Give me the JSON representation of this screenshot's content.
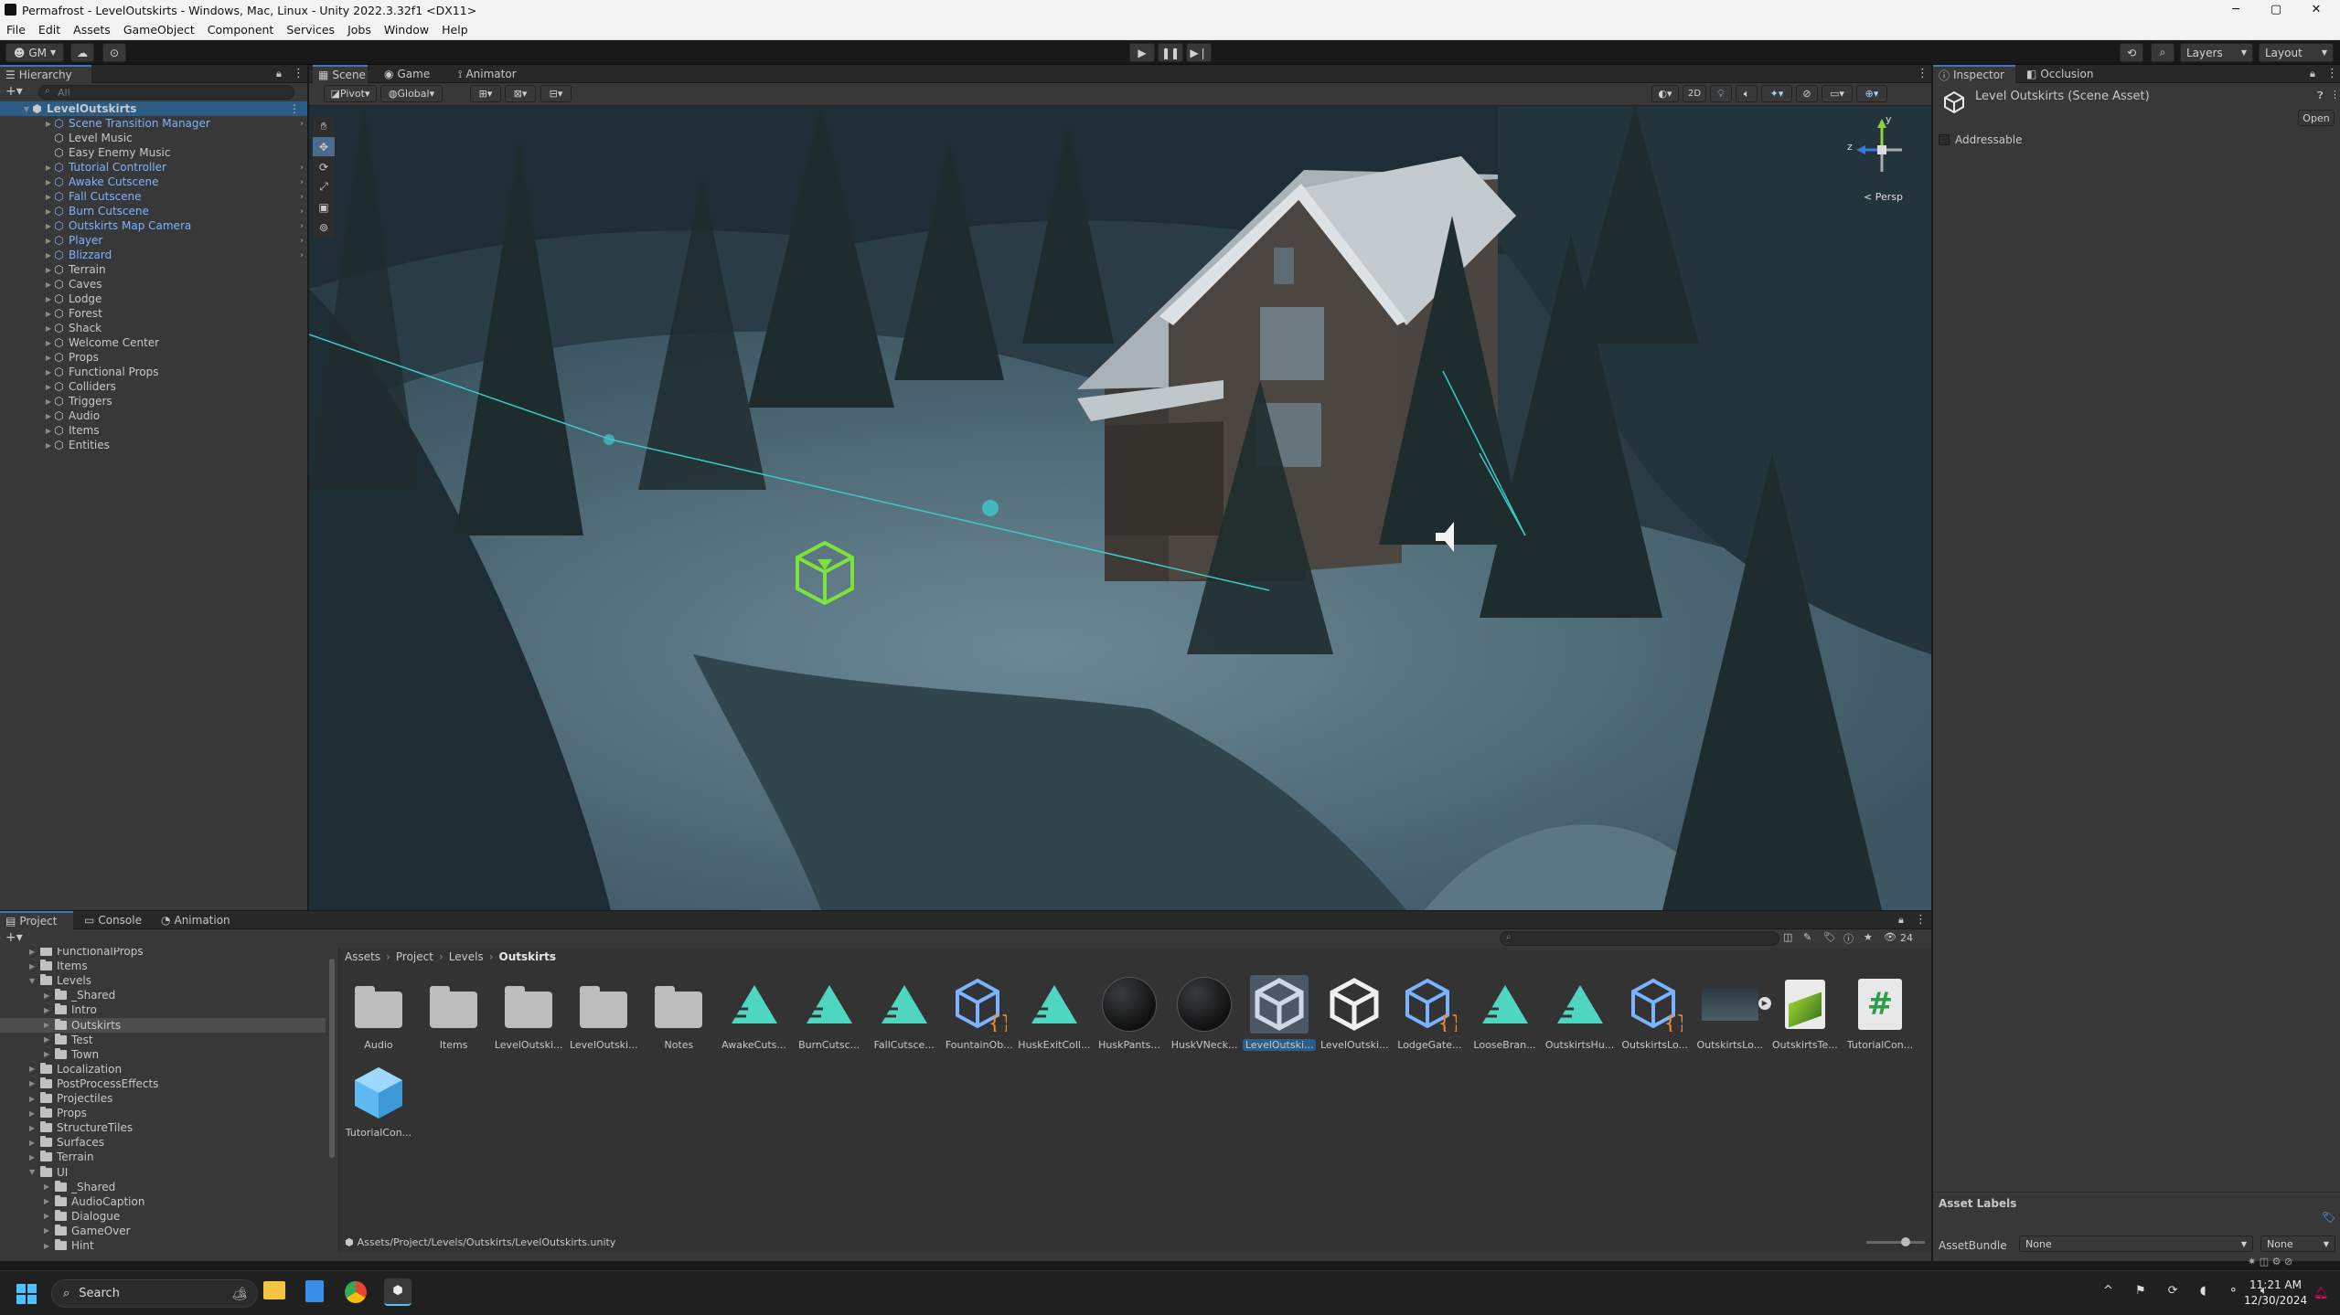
{
  "window": {
    "title": "Permafrost - LevelOutskirts - Windows, Mac, Linux - Unity 2022.3.32f1 <DX11>",
    "controls": [
      "─",
      "▢",
      "✕"
    ]
  },
  "menu": [
    "File",
    "Edit",
    "Assets",
    "GameObject",
    "Component",
    "Services",
    "Jobs",
    "Window",
    "Help"
  ],
  "toolbar": {
    "account": "GM",
    "play_icon": "play-icon",
    "pause_icon": "pause-icon",
    "step_icon": "step-icon",
    "layers": "Layers",
    "layout": "Layout"
  },
  "hierarchy": {
    "tab": "Hierarchy",
    "search_placeholder": "All",
    "scene": "LevelOutskirts",
    "items": [
      {
        "label": "Scene Transition Manager",
        "prefab": true
      },
      {
        "label": "Level Music",
        "prefab": false
      },
      {
        "label": "Easy Enemy Music",
        "prefab": false
      },
      {
        "label": "Tutorial Controller",
        "prefab": true
      },
      {
        "label": "Awake Cutscene",
        "prefab": true
      },
      {
        "label": "Fall Cutscene",
        "prefab": true
      },
      {
        "label": "Burn Cutscene",
        "prefab": true
      },
      {
        "label": "Outskirts Map Camera",
        "prefab": true
      },
      {
        "label": "Player",
        "prefab": true
      },
      {
        "label": "Blizzard",
        "prefab": true
      },
      {
        "label": "Terrain",
        "prefab": false
      },
      {
        "label": "Caves",
        "prefab": false
      },
      {
        "label": "Lodge",
        "prefab": false
      },
      {
        "label": "Forest",
        "prefab": false
      },
      {
        "label": "Shack",
        "prefab": false
      },
      {
        "label": "Welcome Center",
        "prefab": false
      },
      {
        "label": "Props",
        "prefab": false
      },
      {
        "label": "Functional Props",
        "prefab": false
      },
      {
        "label": "Colliders",
        "prefab": false
      },
      {
        "label": "Triggers",
        "prefab": false
      },
      {
        "label": "Audio",
        "prefab": false
      },
      {
        "label": "Items",
        "prefab": false
      },
      {
        "label": "Entities",
        "prefab": false
      }
    ]
  },
  "scene_tabs": [
    "Scene",
    "Game",
    "Animator"
  ],
  "scene_toolbar": {
    "pivot": "Pivot",
    "global": "Global",
    "mode2d": "2D",
    "persp": "< Persp",
    "axis_y": "y",
    "axis_z": "z"
  },
  "inspector": {
    "tabs": [
      "Inspector",
      "Occlusion"
    ],
    "asset_title": "Level Outskirts (Scene Asset)",
    "open_button": "Open",
    "addressable": "Addressable",
    "asset_labels": "Asset Labels",
    "asset_bundle_label": "AssetBundle",
    "asset_bundle_value": "None",
    "asset_variant_value": "None"
  },
  "project": {
    "tabs": [
      "Project",
      "Console",
      "Animation"
    ],
    "hidden_count": "24",
    "breadcrumb": [
      "Assets",
      "Project",
      "Levels",
      "Outskirts"
    ],
    "path": "Assets/Project/Levels/Outskirts/LevelOutskirts.unity",
    "tree": [
      {
        "label": "FunctionalProps",
        "depth": 1,
        "open": false
      },
      {
        "label": "Items",
        "depth": 1,
        "open": false
      },
      {
        "label": "Levels",
        "depth": 1,
        "open": true
      },
      {
        "label": "_Shared",
        "depth": 2,
        "open": false
      },
      {
        "label": "Intro",
        "depth": 2,
        "open": false
      },
      {
        "label": "Outskirts",
        "depth": 2,
        "open": false,
        "selected": true
      },
      {
        "label": "Test",
        "depth": 2,
        "open": false
      },
      {
        "label": "Town",
        "depth": 2,
        "open": false
      },
      {
        "label": "Localization",
        "depth": 1,
        "open": false
      },
      {
        "label": "PostProcessEffects",
        "depth": 1,
        "open": false
      },
      {
        "label": "Projectiles",
        "depth": 1,
        "open": false
      },
      {
        "label": "Props",
        "depth": 1,
        "open": false
      },
      {
        "label": "StructureTiles",
        "depth": 1,
        "open": false
      },
      {
        "label": "Surfaces",
        "depth": 1,
        "open": false
      },
      {
        "label": "Terrain",
        "depth": 1,
        "open": false
      },
      {
        "label": "UI",
        "depth": 1,
        "open": true
      },
      {
        "label": "_Shared",
        "depth": 2,
        "open": false
      },
      {
        "label": "AudioCaption",
        "depth": 2,
        "open": false
      },
      {
        "label": "Dialogue",
        "depth": 2,
        "open": false
      },
      {
        "label": "GameOver",
        "depth": 2,
        "open": false
      },
      {
        "label": "Hint",
        "depth": 2,
        "open": false
      }
    ],
    "assets": [
      {
        "label": "Audio",
        "kind": "folder"
      },
      {
        "label": "Items",
        "kind": "folder"
      },
      {
        "label": "LevelOutski...",
        "kind": "folder"
      },
      {
        "label": "LevelOutski...",
        "kind": "folder"
      },
      {
        "label": "Notes",
        "kind": "folder"
      },
      {
        "label": "AwakeCuts...",
        "kind": "timeline"
      },
      {
        "label": "BurnCutsc...",
        "kind": "timeline"
      },
      {
        "label": "FallCutsce...",
        "kind": "timeline"
      },
      {
        "label": "FountainOb...",
        "kind": "prefab-script"
      },
      {
        "label": "HuskExitColl...",
        "kind": "timeline"
      },
      {
        "label": "HuskPants...",
        "kind": "material"
      },
      {
        "label": "HuskVNeck...",
        "kind": "material"
      },
      {
        "label": "LevelOutski...",
        "kind": "unity-selected"
      },
      {
        "label": "LevelOutski...",
        "kind": "unity"
      },
      {
        "label": "LodgeGate...",
        "kind": "prefab-script"
      },
      {
        "label": "LooseBran...",
        "kind": "timeline"
      },
      {
        "label": "OutskirtsHu...",
        "kind": "timeline"
      },
      {
        "label": "OutskirtsLo...",
        "kind": "prefab-script"
      },
      {
        "label": "OutskirtsLo...",
        "kind": "image"
      },
      {
        "label": "OutskirtsTe...",
        "kind": "terrain"
      },
      {
        "label": "TutorialCon...",
        "kind": "script"
      },
      {
        "label": "TutorialCon...",
        "kind": "prefab"
      }
    ]
  },
  "taskbar": {
    "search": "Search",
    "time": "11:21 AM",
    "date": "12/30/2024"
  },
  "colors": {
    "accent": "#3a79bb",
    "prefab": "#7ab3ff",
    "timeline": "#4fd6c0",
    "gizmo": "#7de33a"
  }
}
